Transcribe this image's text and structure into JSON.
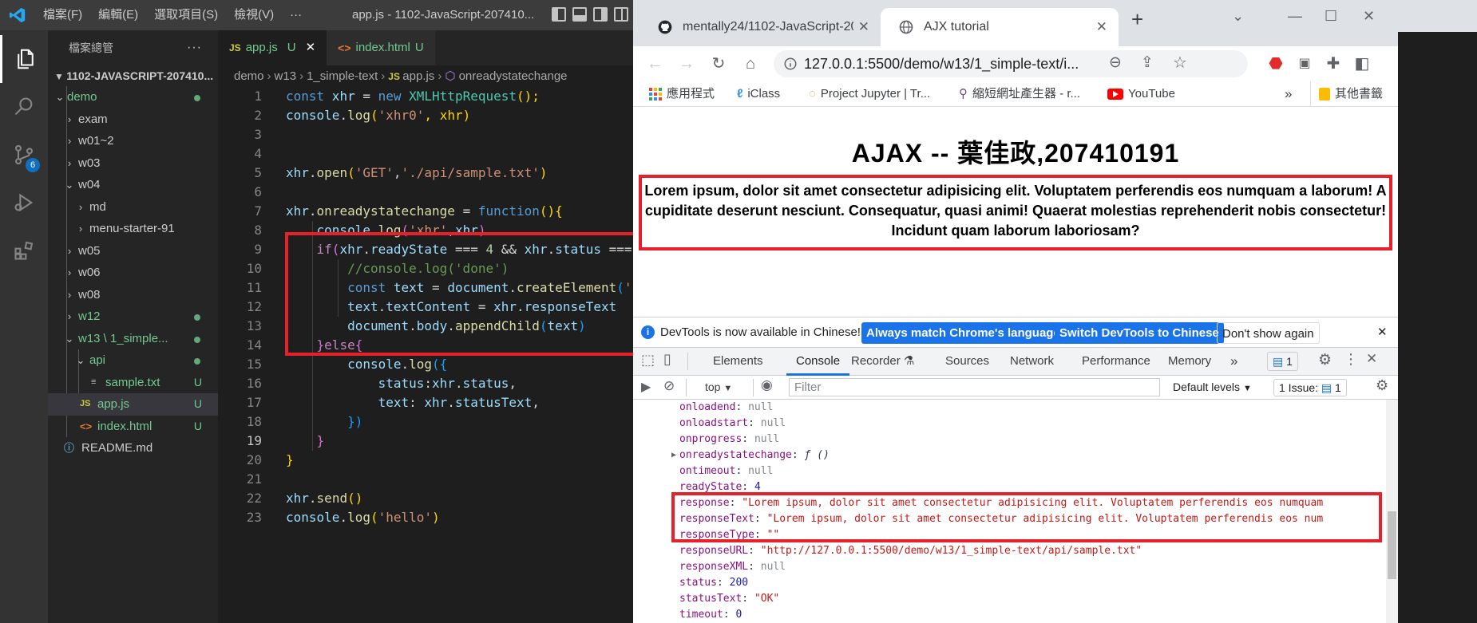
{
  "vscode": {
    "menu": [
      "檔案(F)",
      "編輯(E)",
      "選取項目(S)",
      "檢視(V)",
      "···"
    ],
    "window_title": "app.js - 1102-JavaScript-207410...",
    "explorer_title": "檔案總管",
    "explorer_more": "···",
    "root_folder": "1102-JAVASCRIPT-207410...",
    "tree": [
      {
        "label": "demo"
      },
      {
        "label": "exam"
      },
      {
        "label": "w01~2"
      },
      {
        "label": "w03"
      },
      {
        "label": "w04"
      },
      {
        "label": "md"
      },
      {
        "label": "menu-starter-91"
      },
      {
        "label": "w05"
      },
      {
        "label": "w06"
      },
      {
        "label": "w08"
      },
      {
        "label": "w12"
      },
      {
        "label": "w13 \\ 1_simple..."
      },
      {
        "label": "api"
      },
      {
        "label": "sample.txt",
        "status": "U"
      },
      {
        "label": "app.js",
        "status": "U"
      },
      {
        "label": "index.html",
        "status": "U"
      },
      {
        "label": "README.md"
      }
    ],
    "scm_badge": "6",
    "tabs": [
      {
        "icon": "JS",
        "label": "app.js",
        "status": "U",
        "close": "✕"
      },
      {
        "icon": "<>",
        "label": "index.html",
        "status": "U"
      }
    ],
    "breadcrumb": [
      "demo",
      "w13",
      "1_simple-text",
      "app.js",
      "onreadystatechange"
    ],
    "line_numbers": [
      "1",
      "2",
      "3",
      "4",
      "5",
      "6",
      "7",
      "8",
      "9",
      "10",
      "11",
      "12",
      "13",
      "14",
      "15",
      "16",
      "17",
      "18",
      "19",
      "20",
      "21",
      "22",
      "23"
    ],
    "code": [
      [
        "const",
        " xhr",
        " = ",
        "new",
        " XMLHttpRequest",
        "();"
      ],
      [
        "console",
        ".",
        "log",
        "(",
        "'xhr0'",
        ", xhr)"
      ],
      [],
      [],
      [
        "xhr",
        ".",
        "open",
        "(",
        "'GET'",
        ",",
        "'./api/sample.txt'",
        ")"
      ],
      [],
      [
        "xhr",
        ".",
        "onreadystatechange",
        " = ",
        "function",
        "(){"
      ],
      [
        "    console",
        ".",
        "log",
        "(",
        "'xhr'",
        ",",
        "xhr",
        ")"
      ],
      [
        "    if",
        "(",
        "xhr",
        ".",
        "readyState",
        " === ",
        "4",
        " && ",
        "xhr",
        ".",
        "status",
        " ==="
      ],
      [
        "        //console.log('done')"
      ],
      [
        "        const",
        " text",
        " = ",
        "document",
        ".",
        "createElement",
        "(",
        "'h"
      ],
      [
        "        text",
        ".",
        "textContent",
        " = ",
        "xhr",
        ".",
        "responseText"
      ],
      [
        "        document",
        ".",
        "body",
        ".",
        "appendChild",
        "(",
        "text",
        ")"
      ],
      [
        "    }",
        "else",
        "{"
      ],
      [
        "        console",
        ".",
        "log",
        "({"
      ],
      [
        "            status",
        ":",
        "xhr",
        ".",
        "status",
        ","
      ],
      [
        "            text",
        ": ",
        "xhr",
        ".",
        "statusText",
        ","
      ],
      [
        "        })"
      ],
      [
        "    }"
      ],
      [
        "}"
      ],
      [],
      [
        "xhr",
        ".",
        "send",
        "()"
      ],
      [
        "console",
        ".",
        "log",
        "(",
        "'hello'",
        ")"
      ]
    ]
  },
  "chrome": {
    "tabs": [
      {
        "label": "mentally24/1102-JavaScript-20",
        "close": "✕"
      },
      {
        "label": "AJX tutorial",
        "close": "✕"
      }
    ],
    "new_tab": "+",
    "url": "127.0.0.1:5500/demo/w13/1_simple-text/i...",
    "bookmarks": [
      "應用程式",
      "iClass",
      "Project Jupyter | Tr...",
      "縮短網址產生器 - r...",
      "YouTube",
      "»",
      "其他書籤"
    ],
    "page": {
      "heading": "AJAX -- 葉佳政,207410191",
      "paragraph": "Lorem ipsum, dolor sit amet consectetur adipisicing elit. Voluptatem perferendis eos numquam a laborum! A cupiditate deserunt nesciunt. Consequatur, quasi animi! Quaerat molestias reprehenderit nobis consectetur! Incidunt quam laborum laboriosam?"
    },
    "devtools_banner": {
      "text": "DevTools is now available in Chinese!",
      "btn_match": "Always match Chrome's language",
      "btn_switch": "Switch DevTools to Chinese",
      "btn_dismiss": "Don't show again",
      "close": "✕"
    },
    "devtools_tabs": [
      "Elements",
      "Console",
      "Recorder",
      "Sources",
      "Network",
      "Performance",
      "Memory",
      "»"
    ],
    "devtools_issue_badge": "1",
    "context": "top",
    "filter_placeholder": "Filter",
    "default_levels": "Default levels",
    "issues": "1 Issue:",
    "issues_count": "1",
    "console_lines": [
      {
        "key": "onloadend",
        "sep": ": ",
        "val": "null",
        "kind": "null"
      },
      {
        "key": "onloadstart",
        "sep": ": ",
        "val": "null",
        "kind": "null"
      },
      {
        "key": "onprogress",
        "sep": ": ",
        "val": "null",
        "kind": "null"
      },
      {
        "key": "onreadystatechange",
        "sep": ": ",
        "val": "ƒ ()",
        "kind": "fn"
      },
      {
        "key": "ontimeout",
        "sep": ": ",
        "val": "null",
        "kind": "null"
      },
      {
        "key": "readyState",
        "sep": ": ",
        "val": "4",
        "kind": "num"
      },
      {
        "key": "response",
        "sep": ": ",
        "val": "\"Lorem ipsum, dolor sit amet consectetur adipisicing elit. Voluptatem perferendis eos numquam",
        "kind": "str"
      },
      {
        "key": "responseText",
        "sep": ": ",
        "val": "\"Lorem ipsum, dolor sit amet consectetur adipisicing elit. Voluptatem perferendis eos num",
        "kind": "str"
      },
      {
        "key": "responseType",
        "sep": ": ",
        "val": "\"\"",
        "kind": "str"
      },
      {
        "key": "responseURL",
        "sep": ": ",
        "val": "\"http://127.0.0.1:5500/demo/w13/1_simple-text/api/sample.txt\"",
        "kind": "str"
      },
      {
        "key": "responseXML",
        "sep": ": ",
        "val": "null",
        "kind": "null"
      },
      {
        "key": "status",
        "sep": ": ",
        "val": "200",
        "kind": "num"
      },
      {
        "key": "statusText",
        "sep": ": ",
        "val": "\"OK\"",
        "kind": "str"
      },
      {
        "key": "timeout",
        "sep": ": ",
        "val": "0",
        "kind": "num"
      }
    ]
  }
}
